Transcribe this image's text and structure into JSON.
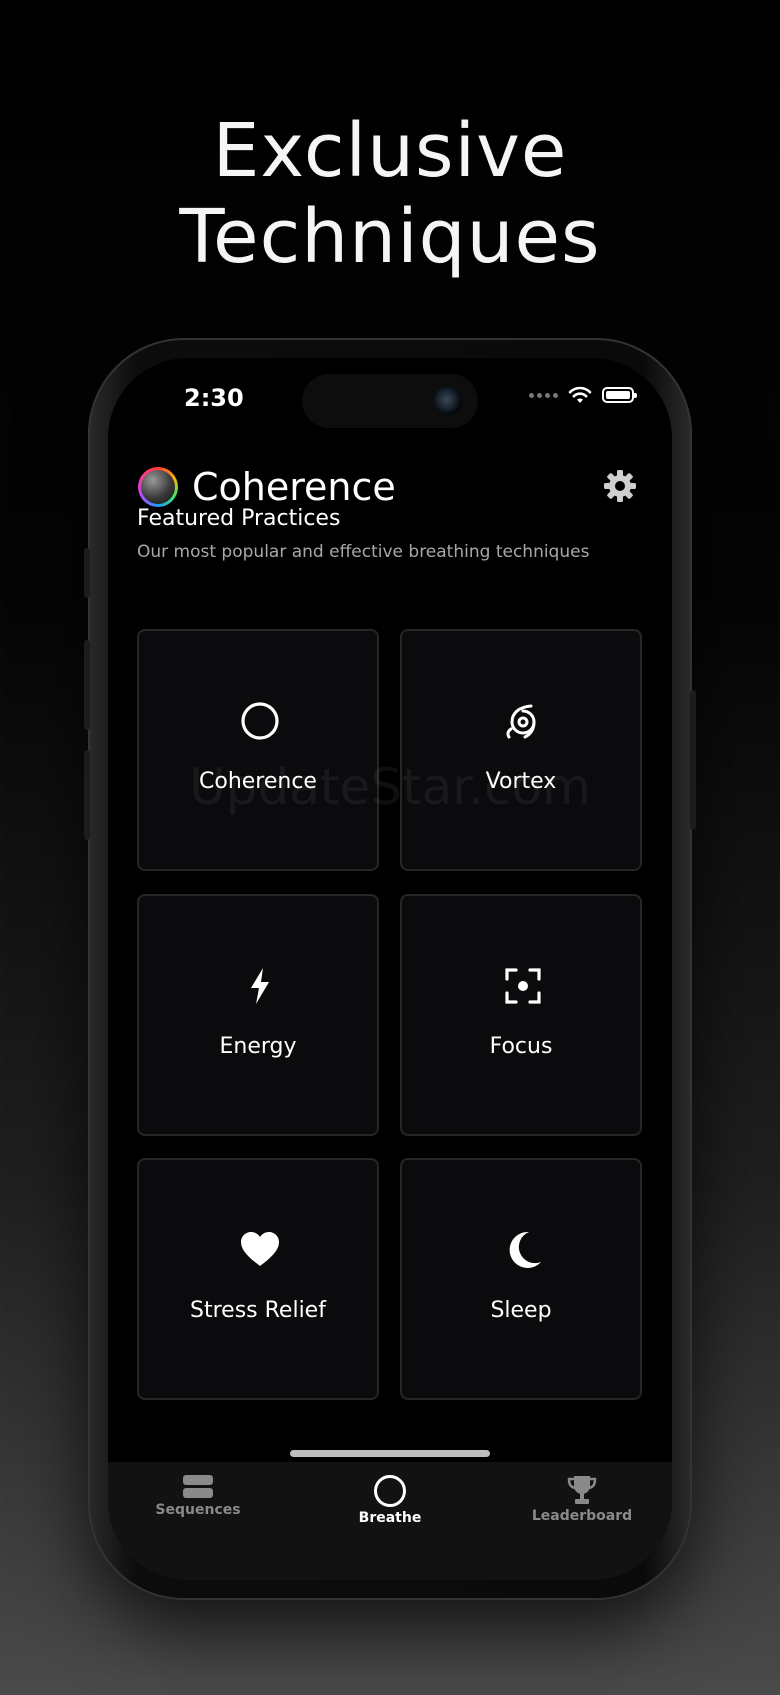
{
  "headline": {
    "line1": "Exclusive",
    "line2": "Techniques"
  },
  "status_bar": {
    "time": "2:30"
  },
  "header": {
    "title": "Coherence"
  },
  "featured": {
    "title": "Featured Practices",
    "subtitle": "Our most popular and effective breathing techniques"
  },
  "practices": [
    {
      "label": "Coherence",
      "icon": "circle-icon"
    },
    {
      "label": "Vortex",
      "icon": "vortex-icon"
    },
    {
      "label": "Energy",
      "icon": "lightning-bolt-icon"
    },
    {
      "label": "Focus",
      "icon": "focus-target-icon"
    },
    {
      "label": "Stress Relief",
      "icon": "heart-icon"
    },
    {
      "label": "Sleep",
      "icon": "moon-icon"
    }
  ],
  "watermark": "UpdateStar.com",
  "tabbar": {
    "tabs": [
      {
        "label": "Sequences",
        "icon": "stack-icon",
        "active": false
      },
      {
        "label": "Breathe",
        "icon": "circle-icon",
        "active": true
      },
      {
        "label": "Leaderboard",
        "icon": "trophy-icon",
        "active": false
      }
    ]
  },
  "colors": {
    "background": "#000000",
    "card_border": "#262626",
    "text_primary": "#ffffff",
    "text_secondary": "#a8a8a8",
    "tab_inactive": "#8a8a8a"
  }
}
